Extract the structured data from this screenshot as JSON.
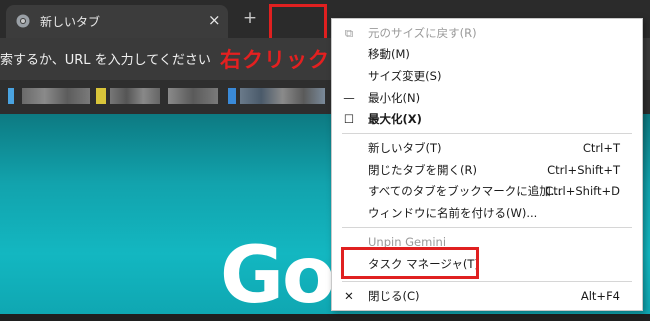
{
  "tab": {
    "title": "新しいタブ",
    "close": "×"
  },
  "new_tab_button": "+",
  "omnibox": {
    "text": "索するか、URL を入力してください"
  },
  "annotation": {
    "label": "右クリック",
    "color": "#e02020"
  },
  "page": {
    "logo_fragment": "Go  le"
  },
  "menu": {
    "items": [
      {
        "icon": "restore-icon",
        "label": "元のサイズに戻す(R)",
        "shortcut": "",
        "disabled": true
      },
      {
        "icon": "",
        "label": "移動(M)",
        "shortcut": "",
        "disabled": false
      },
      {
        "icon": "",
        "label": "サイズ変更(S)",
        "shortcut": "",
        "disabled": false
      },
      {
        "icon": "minimize-icon",
        "label": "最小化(N)",
        "shortcut": "",
        "disabled": false
      },
      {
        "icon": "maximize-icon",
        "label": "最大化(X)",
        "shortcut": "",
        "disabled": false,
        "bold": true
      },
      {
        "icon": "",
        "label": "新しいタブ(T)",
        "shortcut": "Ctrl+T",
        "disabled": false
      },
      {
        "icon": "",
        "label": "閉じたタブを開く(R)",
        "shortcut": "Ctrl+Shift+T",
        "disabled": false
      },
      {
        "icon": "",
        "label": "すべてのタブをブックマークに追加...",
        "shortcut": "Ctrl+Shift+D",
        "disabled": false
      },
      {
        "icon": "",
        "label": "ウィンドウに名前を付ける(W)...",
        "shortcut": "",
        "disabled": false
      },
      {
        "icon": "",
        "label": "Unpin Gemini",
        "shortcut": "",
        "disabled": true
      },
      {
        "icon": "",
        "label": "タスク マネージャ(T)",
        "shortcut": "",
        "disabled": false
      },
      {
        "icon": "close-icon",
        "label": "閉じる(C)",
        "shortcut": "Alt+F4",
        "disabled": false
      }
    ]
  }
}
